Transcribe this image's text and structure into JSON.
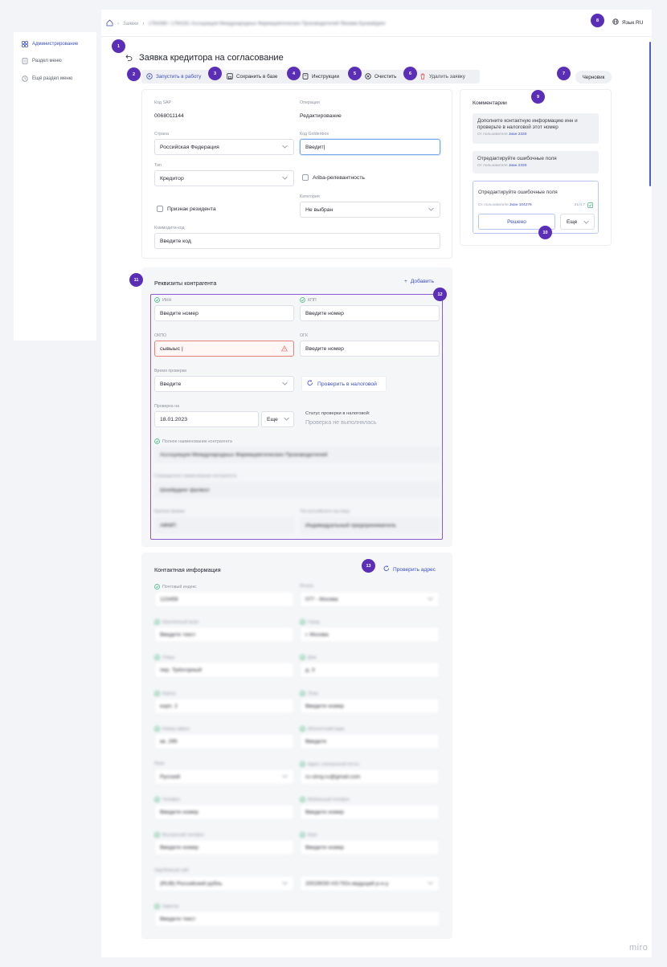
{
  "sidebar": {
    "items": [
      {
        "label": "Администрирование",
        "active": true
      },
      {
        "label": "Раздел меню",
        "active": false
      },
      {
        "label": "Ещё раздел меню",
        "active": false
      }
    ]
  },
  "header": {
    "crumb_1": "Заявки",
    "crumb_2": "1764288 / 1764181 Ассоциация Международных Фармацевтических Производителей Яинами Бухмайдинг",
    "lang": "Язык RU"
  },
  "page": {
    "title": "Заявка кредитора на согласование",
    "status": "Черновик"
  },
  "toolbar": {
    "start": "Запустить в работу",
    "save": "Сохранить в базе",
    "instructions": "Инструкции",
    "clear": "Очистить",
    "delete": "Удалить заявку"
  },
  "general": {
    "sap_label": "Код SAP",
    "sap_value": "0068011144",
    "operation_label": "Операция",
    "operation_value": "Редактирование",
    "country_label": "Страна",
    "country_value": "Российская Федерация",
    "goldenbox_label": "Код Goldenbox",
    "goldenbox_value": "Введит|",
    "type_label": "Тип",
    "type_value": "Кредитор",
    "ariba_label": "Ariba-релевантность",
    "category_label": "Категория",
    "category_value": "Не выбран",
    "resident_label": "Признак резидента",
    "commodity_label": "Коммодити-код",
    "commodity_placeholder": "Введите код"
  },
  "comments": {
    "title": "Комментарии",
    "items": [
      {
        "text": "Дополните контактную информацию инн и проверьте  в налоговой этот номер",
        "meta_prefix": "От пользователя",
        "author": "Jиан 2330"
      },
      {
        "text": "Отредактируйте ошибочные поля",
        "meta_prefix": "От пользователя",
        "author": "Jиан 2330"
      },
      {
        "text": "Отредактируйте ошибочные поля",
        "meta_prefix": "От пользователя",
        "author": "Jиан 104276",
        "date": "21/4.7"
      }
    ],
    "resolve": "Решено",
    "more": "Еще"
  },
  "requisites": {
    "title": "Реквизиты контрагента",
    "add": "Добавить",
    "inn_label": "ИНН",
    "inn_placeholder": "Введите номер",
    "kpp_label": "КПП",
    "kpp_placeholder": "Введите номер",
    "okpo_label": "ОКПО",
    "okpo_value": "сывыыс |",
    "ogk_label": "ОГК",
    "ogk_placeholder": "Введите номер",
    "check_time_label": "Время проверки",
    "check_time_value": "Введите",
    "check_tax_btn": "Проверить в налоговой",
    "check_date_label": "Проверка на",
    "check_date_value": "18.01.2023",
    "more": "Еще",
    "status_caption": "Статус проверки в налоговой:",
    "status_value": "Проверка не выполнялась",
    "full_name_label": "Полное наименование контрагента",
    "full_name_value": "Ассоциация Международных Фармацевтических Производителей",
    "short_name_label": "Сокращенное наименование контрагента",
    "short_name_value": "Шоейрдинг фалвол",
    "ogrn_label": "Краткая форма",
    "ogrn_value": "АФМП",
    "legal_form_label": "Тип российского юр.лица",
    "legal_form_value": "Индивидуальный предприниматель"
  },
  "contacts": {
    "title": "Контактная информация",
    "check_address": "Проверить адрес",
    "fields": [
      {
        "label": "Почтовый индекс",
        "value": "123456",
        "select": false,
        "check": true
      },
      {
        "label": "Регион",
        "value": "077 - Москва",
        "select": true,
        "check": false
      },
      {
        "label": "Населенный пункт",
        "value": "Введите текст",
        "select": false,
        "check": true
      },
      {
        "label": "Город",
        "value": "г. Москва",
        "select": false,
        "check": true
      },
      {
        "label": "Улица",
        "value": "пер. Трёхгорный",
        "select": false,
        "check": true
      },
      {
        "label": "Дом",
        "value": "д. 3",
        "select": false,
        "check": true
      },
      {
        "label": "Корпус",
        "value": "корп. 2",
        "select": false,
        "check": true
      },
      {
        "label": "Этаж",
        "value": "Введите номер",
        "select": false,
        "check": true
      },
      {
        "label": "Номер офиса",
        "value": "кв. 295",
        "select": false,
        "check": true
      },
      {
        "label": "Абонентский ящик",
        "value": "Введите",
        "select": false,
        "check": true
      },
      {
        "label": "Язык",
        "value": "Русский",
        "select": true,
        "check": false
      },
      {
        "label": "Адрес электронной почты",
        "value": "ru-stroy.ru@gmail.com",
        "select": false,
        "check": true
      },
      {
        "label": "Телефон",
        "value": "Введите номер",
        "select": false,
        "check": true
      },
      {
        "label": "Мобильный телефон",
        "value": "Введите номер",
        "select": false,
        "check": true
      },
      {
        "label": "Внутренний телефон",
        "value": "Введите номер",
        "select": false,
        "check": true
      },
      {
        "label": "Факс",
        "value": "Введите номер",
        "select": false,
        "check": true
      },
      {
        "label": "Зарубежный сайт",
        "value": "(RUB) Российский рубль",
        "select": true,
        "check": false
      },
      {
        "label": "",
        "value": "20029030 НЗ ПОз ведущий р-н-у",
        "select": true,
        "check": false
      },
      {
        "label": "Заметка",
        "value": "Введите текст",
        "select": false,
        "check": true
      }
    ]
  },
  "badges": [
    "1",
    "2",
    "3",
    "4",
    "5",
    "6",
    "7",
    "8",
    "9",
    "10",
    "11",
    "12",
    "13"
  ],
  "watermark": "miro",
  "colors": {
    "accent": "#3b4fc4",
    "badge": "#5b2eb8",
    "error": "#e8817b",
    "check": "#39b37c"
  }
}
